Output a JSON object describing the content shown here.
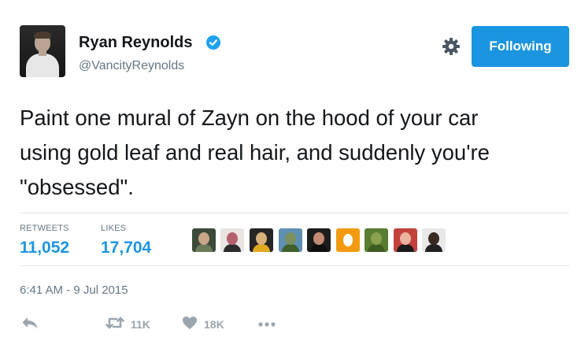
{
  "author": {
    "name": "Ryan Reynolds",
    "handle": "@VancityReynolds",
    "verified": true
  },
  "header": {
    "follow_label": "Following"
  },
  "tweet": {
    "lines": [
      "Paint one mural of Zayn on the hood of your car",
      "using gold leaf and real hair, and suddenly you're",
      "\"obsessed\"."
    ],
    "timestamp": "6:41 AM - 9 Jul 2015"
  },
  "stats": {
    "retweets_label": "RETWEETS",
    "retweets_value": "11,052",
    "likes_label": "LIKES",
    "likes_value": "17,704"
  },
  "actions": {
    "retweet_count": "11K",
    "like_count": "18K"
  },
  "colors": {
    "accent": "#1b95e0",
    "muted": "#657786",
    "text": "#14171a"
  },
  "icons": [
    "verified-badge-icon",
    "gear-icon",
    "reply-icon",
    "retweet-icon",
    "heart-icon",
    "more-icon"
  ]
}
